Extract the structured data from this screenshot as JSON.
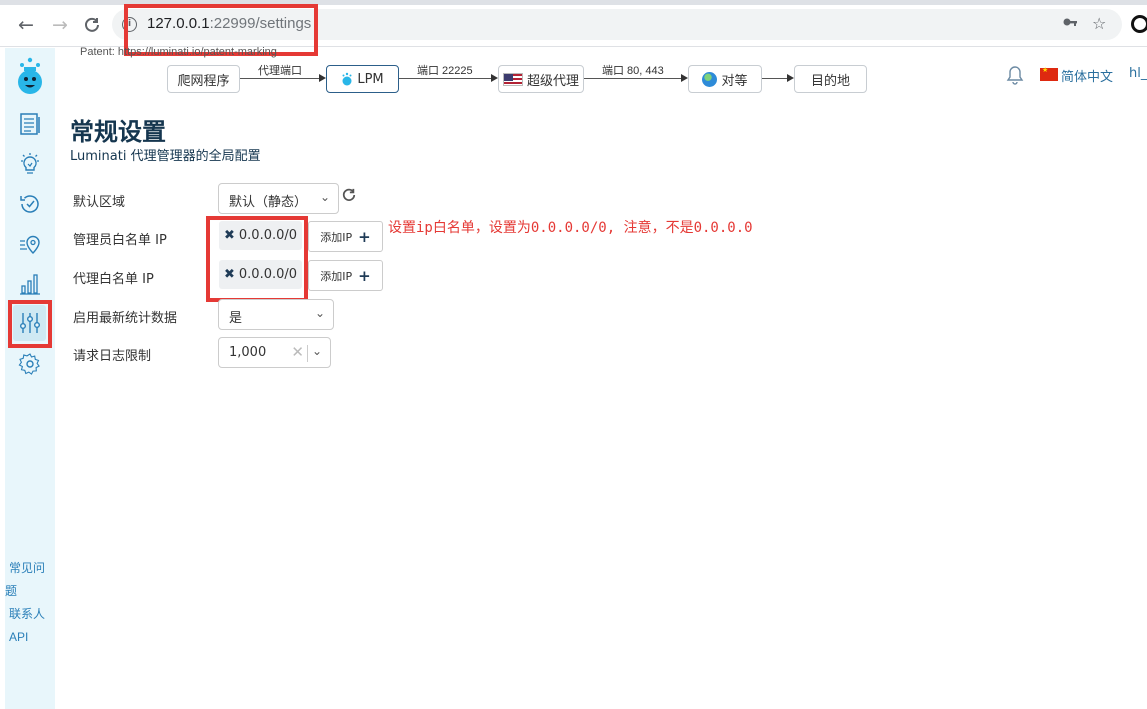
{
  "browser": {
    "url_host": "127.0.0.1",
    "url_rest": ":22999/settings",
    "info_glyph": "i"
  },
  "patent": "Patent: https://luminati.io/patent-marking",
  "flow": {
    "crawler": "爬网程序",
    "proxy_port_label": "代理端口",
    "lpm": "LPM",
    "port_label": "端口 22225",
    "super_proxy": "超级代理",
    "ports_label": "端口 80, 443",
    "peer": "对等",
    "destination": "目的地"
  },
  "header": {
    "language": "简体中文",
    "user": "hl_"
  },
  "sidebar": {
    "links": [
      "常见问",
      "题",
      "联系人",
      "API"
    ]
  },
  "page": {
    "title": "常规设置",
    "subtitle": "Luminati 代理管理器的全局配置"
  },
  "settings": {
    "zone_label": "默认区域",
    "zone_value": "默认（静态）",
    "admin_whitelist_label": "管理员白名单 IP",
    "admin_whitelist_ip": "0.0.0.0/0",
    "proxy_whitelist_label": "代理白名单 IP",
    "proxy_whitelist_ip": "0.0.0.0/0",
    "add_ip": "添加IP",
    "stats_label": "启用最新统计数据",
    "stats_value": "是",
    "log_limit_label": "请求日志限制",
    "log_limit_value": "1,000"
  },
  "annotation": "设置ip白名单，设置为0.0.0.0/0, 注意，不是0.0.0.0",
  "colors": {
    "highlight": "#e53935",
    "sidebar_bg": "#e8f6fb",
    "title": "#15364f"
  }
}
